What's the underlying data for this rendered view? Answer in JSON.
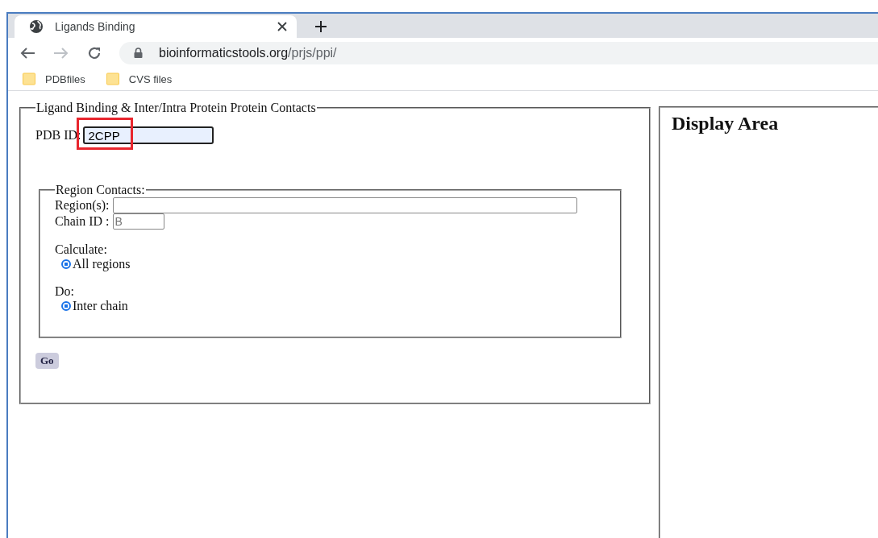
{
  "browser": {
    "tab": {
      "title": "Ligands Binding",
      "selected": true
    },
    "address": {
      "domain": "bioinformaticstools.org",
      "path": "/prjs/ppi/"
    },
    "bookmarks": [
      {
        "label": "PDBfiles"
      },
      {
        "label": "CVS files"
      }
    ]
  },
  "form": {
    "legend": "Ligand Binding & Inter/Intra Protein Protein Contacts",
    "pdb_id": {
      "label": "PDB ID:",
      "value": "2CPP",
      "highlighted": true
    },
    "region_contacts": {
      "legend": "Region Contacts:",
      "region": {
        "label": "Region(s):"
      },
      "chain": {
        "label": "Chain ID :",
        "placeholder": "B"
      },
      "calculate": {
        "label": "Calculate:",
        "options": [
          {
            "label": "All regions",
            "selected": true
          }
        ]
      },
      "do": {
        "label": "Do:",
        "options": [
          {
            "label": "Inter chain",
            "selected": true
          }
        ]
      }
    },
    "go_button": "Go"
  },
  "display": {
    "title": "Display Area"
  }
}
